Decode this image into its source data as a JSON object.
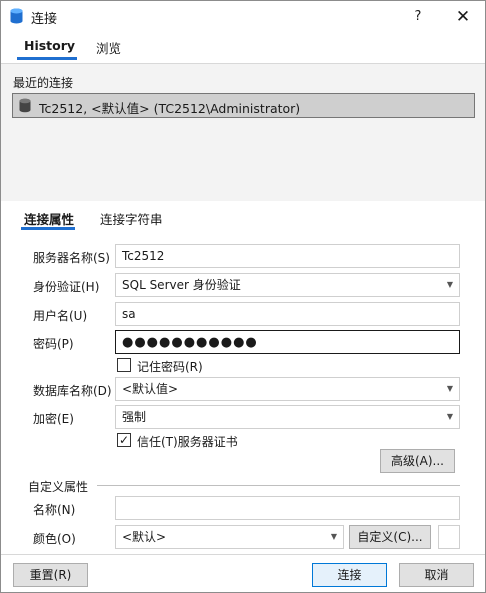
{
  "window": {
    "title": "连接",
    "help_label": "?",
    "close_label": "✕"
  },
  "tabs_top": [
    {
      "label": "History"
    },
    {
      "label": "浏览"
    }
  ],
  "recent": {
    "label": "最近的连接",
    "items": [
      {
        "text": "Tc2512, <默认值> (TC2512\\Administrator)"
      }
    ]
  },
  "tabs_props": [
    {
      "label": "连接属性"
    },
    {
      "label": "连接字符串"
    }
  ],
  "form": {
    "server_label": "服务器名称(S)",
    "server_value": "Tc2512",
    "auth_label": "身份验证(H)",
    "auth_value": "SQL Server 身份验证",
    "user_label": "用户名(U)",
    "user_value": "sa",
    "password_label": "密码(P)",
    "password_value": "●●●●●●●●●●●",
    "remember_label": "记住密码(R)",
    "database_label": "数据库名称(D)",
    "database_value": "<默认值>",
    "encrypt_label": "加密(E)",
    "encrypt_value": "强制",
    "trust_label": "信任(T)服务器证书",
    "trust_check": "✓",
    "advanced_label": "高级(A)..."
  },
  "custom": {
    "section_label": "自定义属性",
    "name_label": "名称(N)",
    "name_value": "",
    "color_label": "颜色(O)",
    "color_value": "<默认>",
    "custom_btn_label": "自定义(C)..."
  },
  "footer": {
    "reset_label": "重置(R)",
    "connect_label": "连接",
    "cancel_label": "取消"
  },
  "colors": {
    "accent": "#1f6fd0",
    "selected_row": "#cfcfcf",
    "primary_border": "#0078d7"
  }
}
